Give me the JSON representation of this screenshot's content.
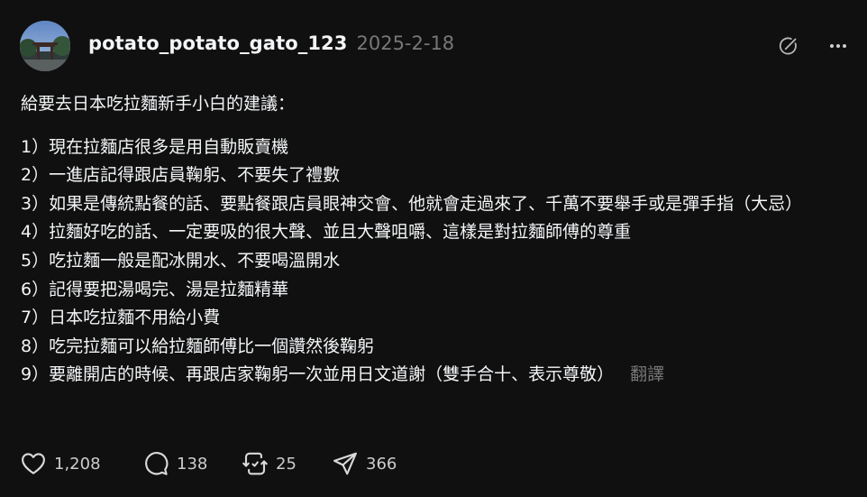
{
  "post": {
    "username": "potato_potato_gato_123",
    "timestamp": "2025-2-18",
    "intro": "給要去日本吃拉麵新手小白的建議：",
    "lines": [
      "1）現在拉麵店很多是用自動販賣機",
      "2）一進店記得跟店員鞠躬、不要失了禮數",
      "3）如果是傳統點餐的話、要點餐跟店員眼神交會、他就會走過來了、千萬不要舉手或是彈手指（大忌）",
      "4）拉麵好吃的話、一定要吸的很大聲、並且大聲咀嚼、這樣是對拉麵師傅的尊重",
      "5）吃拉麵一般是配冰開水、不要喝溫開水",
      "6）記得要把湯喝完、湯是拉麵精華",
      "7）日本吃拉麵不用給小費",
      "8）吃完拉麵可以給拉麵師傅比一個讚然後鞠躬",
      "9）要離開店的時候、再跟店家鞠躬一次並用日文道謝（雙手合十、表示尊敬）"
    ],
    "translate_label": "翻譯"
  },
  "actions": {
    "like": {
      "icon": "heart-icon",
      "count": "1,208"
    },
    "comment": {
      "icon": "comment-icon",
      "count": "138"
    },
    "repost": {
      "icon": "repost-icon",
      "count": "25"
    },
    "share": {
      "icon": "send-icon",
      "count": "366"
    }
  },
  "header_icons": [
    "edit-circle-icon",
    "more-icon"
  ],
  "colors": {
    "background": "#101010",
    "text": "#f3f5f7",
    "muted": "#777777"
  }
}
